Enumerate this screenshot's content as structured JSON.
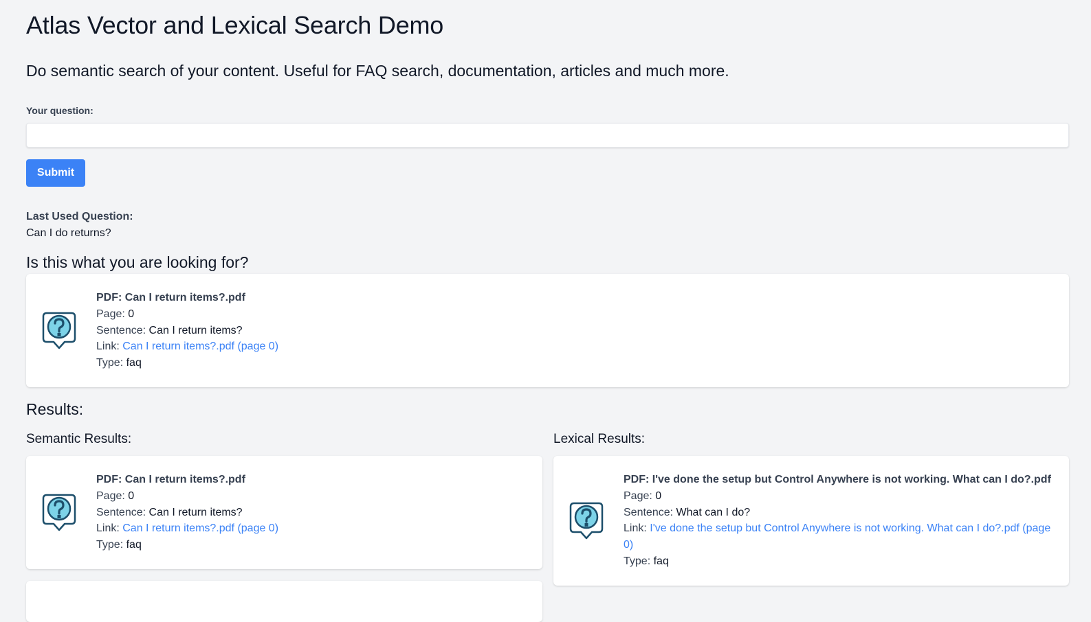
{
  "header": {
    "title": "Atlas Vector and Lexical Search Demo",
    "subtitle": "Do semantic search of your content. Useful for FAQ search, documentation, articles and much more."
  },
  "form": {
    "question_label": "Your question:",
    "question_value": "",
    "question_placeholder": "",
    "submit_label": "Submit"
  },
  "last_used": {
    "label": "Last Used Question:",
    "value": "Can I do returns?"
  },
  "top_match": {
    "heading": "Is this what you are looking for?",
    "pdf_label": "PDF:",
    "pdf": "Can I return items?.pdf",
    "page_label": "Page:",
    "page": "0",
    "sentence_label": "Sentence:",
    "sentence": "Can I return items?",
    "link_label": "Link:",
    "link_text": "Can I return items?.pdf (page 0)",
    "type_label": "Type:",
    "type": "faq",
    "icon": "faq-question-bubble-icon"
  },
  "results": {
    "heading": "Results:",
    "semantic": {
      "heading": "Semantic Results:",
      "items": [
        {
          "pdf_label": "PDF:",
          "pdf": "Can I return items?.pdf",
          "page_label": "Page:",
          "page": "0",
          "sentence_label": "Sentence:",
          "sentence": "Can I return items?",
          "link_label": "Link:",
          "link_text": "Can I return items?.pdf (page 0)",
          "type_label": "Type:",
          "type": "faq",
          "icon": "faq-question-bubble-icon"
        }
      ]
    },
    "lexical": {
      "heading": "Lexical Results:",
      "items": [
        {
          "pdf_label": "PDF:",
          "pdf": "I've done the setup but Control Anywhere is not working. What can I do?.pdf",
          "page_label": "Page:",
          "page": "0",
          "sentence_label": "Sentence:",
          "sentence": "What can I do?",
          "link_label": "Link:",
          "link_text": "I've done the setup but Control Anywhere is not working. What can I do?.pdf (page 0)",
          "type_label": "Type:",
          "type": "faq",
          "icon": "faq-question-bubble-icon"
        }
      ]
    }
  },
  "colors": {
    "background": "#f3f4f6",
    "accent": "#3b82f6",
    "icon_fill": "#7dd3e8",
    "icon_stroke": "#1d4f6b"
  }
}
